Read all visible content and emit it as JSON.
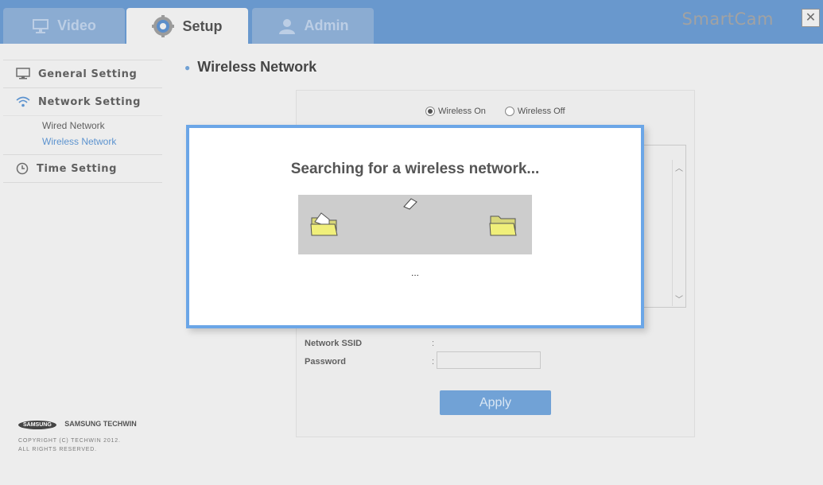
{
  "tabs": [
    {
      "label": "Video",
      "icon": "monitor-icon"
    },
    {
      "label": "Setup",
      "icon": "gear-icon"
    },
    {
      "label": "Admin",
      "icon": "user-icon"
    }
  ],
  "brand": "SmartCam",
  "sidebar": {
    "general": "General Setting",
    "network": "Network Setting",
    "wired": "Wired Network",
    "wireless": "Wireless Network",
    "time": "Time Setting"
  },
  "footer": {
    "samsung_badge": "SAMSUNG",
    "company": "SAMSUNG TECHWIN",
    "copyright_line1": "COPYRIGHT (C) TECHWIN 2012.",
    "copyright_line2": "ALL RIGHTS RESERVED."
  },
  "page": {
    "title": "Wireless Network"
  },
  "wireless": {
    "on_label": "Wireless On",
    "off_label": "Wireless Off",
    "selected": "on"
  },
  "fields": {
    "ssid_label": "Network SSID",
    "password_label": "Password",
    "colon": ":"
  },
  "apply_label": "Apply",
  "modal": {
    "title": "Searching for a wireless network...",
    "status": "..."
  },
  "colors": {
    "accent": "#3f7cbf",
    "selected_link": "#2f75c2",
    "modal_border": "#6ba6e7",
    "apply_button": "#4a88cb"
  }
}
